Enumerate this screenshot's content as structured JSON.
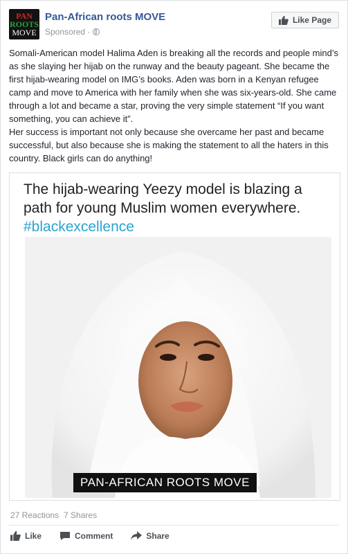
{
  "header": {
    "logo_lines": [
      "PAN",
      "ROOTS",
      "MOVE"
    ],
    "page_name": "Pan-African roots MOVE",
    "meta_text": "Sponsored ·",
    "like_page_label": "Like Page"
  },
  "post": {
    "paragraphs": [
      "Somali-American model Halima Aden is breaking all the records and people mind’s as she slaying her hijab on the runway and the beauty pageant. She became the first hijab-wearing model on IMG’s books. Aden was born in a Kenyan refugee camp and move to America with her family when she was six-years-old. She came through a lot and became a star, proving the very simple statement “If you want something, you can achieve it”.",
      "Her success is important not only because she overcame her past and became successful, but also because she is making the statement to all the haters in this country. Black girls can do anything!"
    ]
  },
  "card": {
    "headline": "The hijab-wearing Yeezy model is blazing a path for young Muslim women everywhere.",
    "hashtag": "#blackexcellence",
    "watermark": "PAN-AFRICAN ROOTS MOVE"
  },
  "stats": {
    "reactions": "27 Reactions",
    "shares": "7 Shares"
  },
  "actions": {
    "like": "Like",
    "comment": "Comment",
    "share": "Share"
  },
  "colors": {
    "link_blue": "#365899",
    "hashtag_blue": "#2aa3ce",
    "meta_gray": "#90949c"
  }
}
